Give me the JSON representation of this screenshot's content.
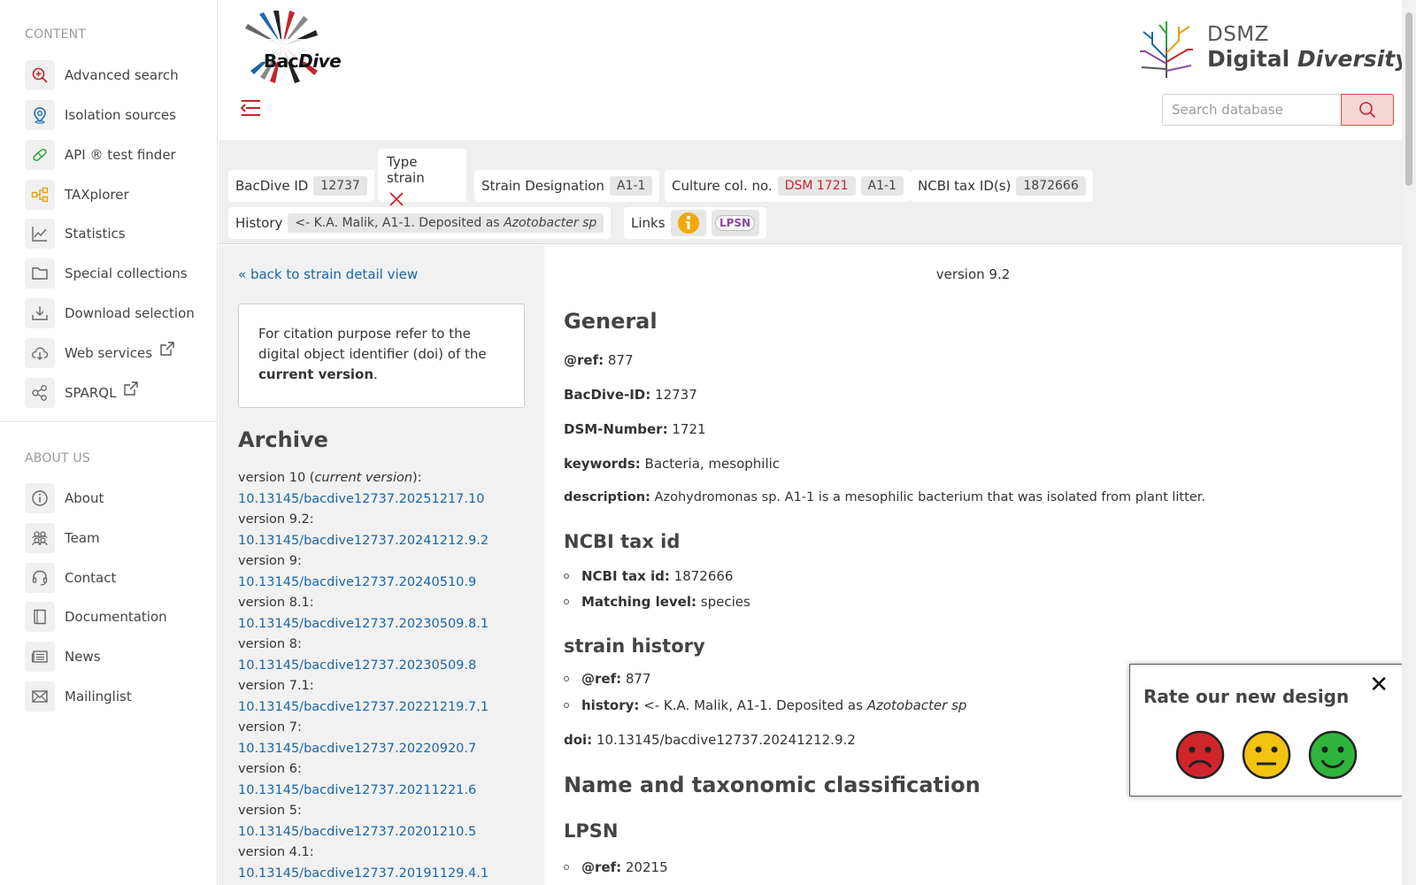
{
  "sidebar": {
    "content_heading": "CONTENT",
    "about_heading": "ABOUT US",
    "content_items": [
      {
        "label": "Advanced search",
        "icon": "search-plus-icon"
      },
      {
        "label": "Isolation sources",
        "icon": "location-pin-icon"
      },
      {
        "label": "API ® test finder",
        "icon": "test-strip-icon"
      },
      {
        "label": "TAXplorer",
        "icon": "tree-icon"
      },
      {
        "label": "Statistics",
        "icon": "chart-icon"
      },
      {
        "label": "Special collections",
        "icon": "folder-icon"
      },
      {
        "label": "Download selection",
        "icon": "download-icon"
      },
      {
        "label": "Web services",
        "icon": "cloud-download-icon"
      },
      {
        "label": "SPARQL",
        "icon": "share-nodes-icon"
      }
    ],
    "about_items": [
      {
        "label": "About",
        "icon": "info-icon"
      },
      {
        "label": "Team",
        "icon": "team-icon"
      },
      {
        "label": "Contact",
        "icon": "headset-icon"
      },
      {
        "label": "Documentation",
        "icon": "book-icon"
      },
      {
        "label": "News",
        "icon": "newspaper-icon"
      },
      {
        "label": "Mailinglist",
        "icon": "mail-icon"
      }
    ]
  },
  "header": {
    "logo_bac": "Bac",
    "logo_dive": "Dive",
    "dsmz_line1": "DSMZ",
    "dsmz_line2a": "Digital",
    "dsmz_line2b": "Diversity",
    "search_placeholder": "Search database"
  },
  "summary": {
    "bacdive_id_label": "BacDive ID",
    "bacdive_id_value": "12737",
    "type_strain_label": "Type strain",
    "strain_designation_label": "Strain Designation",
    "strain_designation_value": "A1-1",
    "culture_col_label": "Culture col. no.",
    "culture_col_value1": "DSM 1721",
    "culture_col_value2": "A1-1",
    "ncbi_label": "NCBI tax ID(s)",
    "ncbi_value": "1872666",
    "history_label": "History",
    "history_value_prefix": "<- K.A. Malik, A1-1. Deposited as",
    "history_value_italic": "Azotobacter sp",
    "links_label": "Links",
    "lpsn_badge": "LPSN"
  },
  "left": {
    "back_link": "« back to strain detail view",
    "cite_text1": "For citation purpose refer to the digital object identifier (doi) of the",
    "cite_bold": "current version",
    "cite_end": ".",
    "archive_title": "Archive",
    "versions": [
      {
        "label": "version 10 (",
        "italic": "current version",
        "suffix": "):",
        "doi": "10.13145/bacdive12737.20251217.10"
      },
      {
        "label": "version 9.2:",
        "italic": "",
        "suffix": "",
        "doi": "10.13145/bacdive12737.20241212.9.2"
      },
      {
        "label": "version 9:",
        "italic": "",
        "suffix": "",
        "doi": "10.13145/bacdive12737.20240510.9"
      },
      {
        "label": "version 8.1:",
        "italic": "",
        "suffix": "",
        "doi": "10.13145/bacdive12737.20230509.8.1"
      },
      {
        "label": "version 8:",
        "italic": "",
        "suffix": "",
        "doi": "10.13145/bacdive12737.20230509.8"
      },
      {
        "label": "version 7.1:",
        "italic": "",
        "suffix": "",
        "doi": "10.13145/bacdive12737.20221219.7.1"
      },
      {
        "label": "version 7:",
        "italic": "",
        "suffix": "",
        "doi": "10.13145/bacdive12737.20220920.7"
      },
      {
        "label": "version 6:",
        "italic": "",
        "suffix": "",
        "doi": "10.13145/bacdive12737.20211221.6"
      },
      {
        "label": "version 5:",
        "italic": "",
        "suffix": "",
        "doi": "10.13145/bacdive12737.20201210.5"
      },
      {
        "label": "version 4.1:",
        "italic": "",
        "suffix": "",
        "doi": "10.13145/bacdive12737.20191129.4.1"
      }
    ]
  },
  "main": {
    "version_label": "version 9.2",
    "general_title": "General",
    "ref_label": "@ref:",
    "ref_value": "877",
    "bacdive_id_label": "BacDive-ID:",
    "bacdive_id_value": "12737",
    "dsm_label": "DSM-Number:",
    "dsm_value": "1721",
    "keywords_label": "keywords:",
    "keywords_value": "Bacteria, mesophilic",
    "description_label": "description:",
    "description_value": "Azohydromonas sp. A1-1 is a mesophilic bacterium that was isolated from plant litter.",
    "ncbi_title": "NCBI tax id",
    "ncbi_tax_label": "NCBI tax id:",
    "ncbi_tax_value": "1872666",
    "matching_label": "Matching level:",
    "matching_value": "species",
    "history_title": "strain history",
    "hist_ref_label": "@ref:",
    "hist_ref_value": "877",
    "hist_label": "history:",
    "hist_value_prefix": "<- K.A. Malik, A1-1. Deposited as",
    "hist_value_italic": "Azotobacter sp",
    "doi_label": "doi:",
    "doi_value": "10.13145/bacdive12737.20241212.9.2",
    "taxonomy_title": "Name and taxonomic classification",
    "lpsn_title": "LPSN",
    "lpsn_ref_label": "@ref:",
    "lpsn_ref_value": "20215"
  },
  "rating": {
    "title": "Rate our new design",
    "close": "✕"
  },
  "colors": {
    "accent_red": "#c3262d",
    "link_blue": "#1a66a8",
    "sad": "#d0262b",
    "neutral": "#f2c40f",
    "happy": "#2fb53c"
  }
}
